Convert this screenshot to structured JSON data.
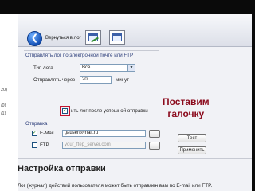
{
  "left_strip": {
    "fragments": [
      "20)",
      "/0)",
      "/1)"
    ]
  },
  "toolbar": {
    "back_label": "Вернуться в лог"
  },
  "email_settings": {
    "group_title": "Отправлять лог по электронной почте или FTP",
    "log_type_label": "Тип лога",
    "log_type_value": "Все",
    "send_every_label": "Отправлять через",
    "send_every_value": "20",
    "minutes_label": "минут",
    "clear_log_checkbox_label": "ить лог после успешной отправки",
    "clear_log_checked": true
  },
  "send": {
    "group_title": "Отправка",
    "email_label": "E-Mail",
    "email_value": "tjauser@mail.ru",
    "email_checked": true,
    "ftp_label": "FTP",
    "ftp_placeholder": "your_ftep_server.com",
    "ftp_checked": false,
    "browse_label": "...",
    "test_label": "Тест",
    "apply_label": "Применить"
  },
  "callout": {
    "line1": "Поставим",
    "line2": "галочку",
    "color": "#8b0a1c"
  },
  "help": {
    "heading": "Настройка отправки",
    "description": "Лог (журнал) действий пользователя может быть отправлен вам по E-mail или FTP."
  }
}
